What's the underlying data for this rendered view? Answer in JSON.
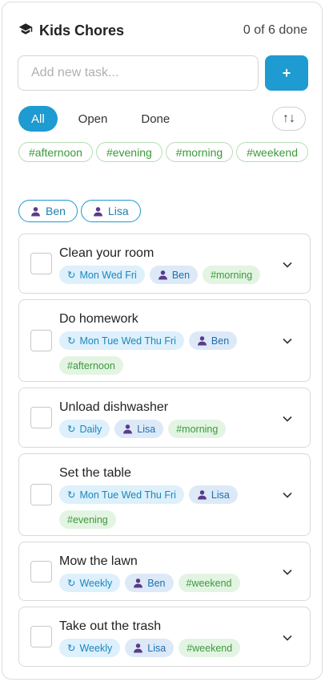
{
  "header": {
    "title": "Kids Chores",
    "progress": "0 of 6 done",
    "icon": "graduation-cap-icon"
  },
  "add": {
    "placeholder": "Add new task...",
    "button_label": "+"
  },
  "filters": [
    "All",
    "Open",
    "Done"
  ],
  "sort_icon": "↑↓",
  "tags": [
    "#afternoon",
    "#evening",
    "#morning",
    "#weekend"
  ],
  "users": [
    "Ben",
    "Lisa"
  ],
  "tasks": [
    {
      "title": "Clean your room",
      "schedule": "Mon Wed Fri",
      "user": "Ben",
      "tag": "#morning",
      "done": false
    },
    {
      "title": "Do homework",
      "schedule": "Mon Tue Wed Thu Fri",
      "user": "Ben",
      "tag": "#afternoon",
      "done": false
    },
    {
      "title": "Unload dishwasher",
      "schedule": "Daily",
      "user": "Lisa",
      "tag": "#morning",
      "done": false
    },
    {
      "title": "Set the table",
      "schedule": "Mon Tue Wed Thu Fri",
      "user": "Lisa",
      "tag": "#evening",
      "done": false
    },
    {
      "title": "Mow the lawn",
      "schedule": "Weekly",
      "user": "Ben",
      "tag": "#weekend",
      "done": false
    },
    {
      "title": "Take out the trash",
      "schedule": "Weekly",
      "user": "Lisa",
      "tag": "#weekend",
      "done": false
    }
  ],
  "colors": {
    "accent": "#1e9bd1",
    "tag_green": "#3a9a3a",
    "user_purple": "#5a3a8a"
  }
}
